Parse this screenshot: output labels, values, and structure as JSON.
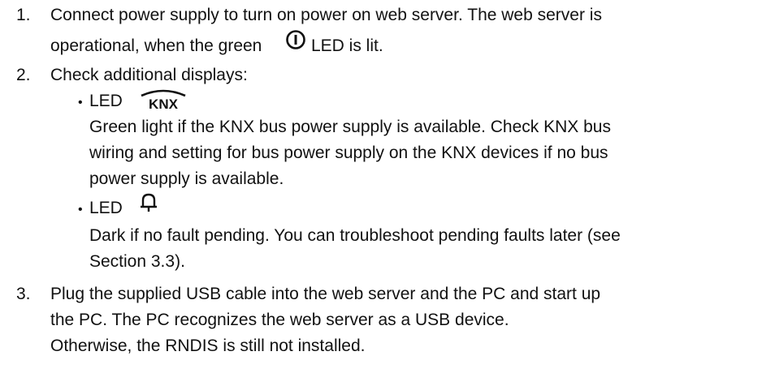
{
  "steps": [
    {
      "number": "1.",
      "lines": [
        "Connect power supply to turn on power on web server. The web server is",
        "operational, when the green",
        "LED is lit."
      ]
    },
    {
      "number": "2.",
      "lines": [
        "Check additional displays:"
      ],
      "items": [
        {
          "bullet": "•",
          "label": "LED",
          "icon": "knx-logo-icon",
          "icon_text": "KNX",
          "lines": [
            "Green light if the KNX bus power supply is available. Check KNX bus",
            "wiring and setting for bus power supply on the KNX devices if no bus",
            "power supply is available."
          ]
        },
        {
          "bullet": "•",
          "label": "LED",
          "icon": "bell-icon",
          "lines": [
            "Dark if no fault pending. You can troubleshoot pending faults later (see",
            "Section 3.3)."
          ]
        }
      ]
    },
    {
      "number": "3.",
      "lines": [
        "Plug the supplied USB cable into the web server and the PC and start up",
        "the PC. The PC recognizes the web server as a USB device.",
        "Otherwise, the RNDIS is still not installed."
      ]
    }
  ]
}
